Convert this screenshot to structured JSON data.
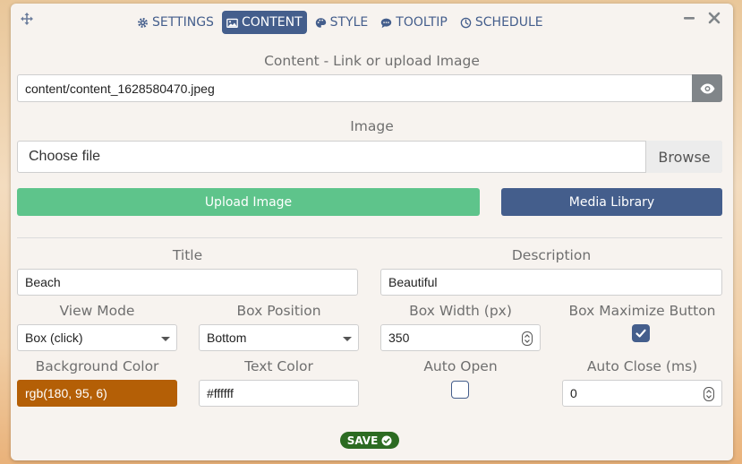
{
  "tabs": [
    {
      "label": "SETTINGS",
      "icon": "gear-icon"
    },
    {
      "label": "CONTENT",
      "icon": "image-icon",
      "active": true
    },
    {
      "label": "STYLE",
      "icon": "palette-icon"
    },
    {
      "label": "TOOLTIP",
      "icon": "comment-icon"
    },
    {
      "label": "SCHEDULE",
      "icon": "clock-icon"
    }
  ],
  "content": {
    "link_label": "Content - Link or upload Image",
    "link_value": "content/content_1628580470.jpeg",
    "image_label": "Image",
    "file_placeholder": "Choose file",
    "browse_label": "Browse",
    "upload_label": "Upload Image",
    "media_label": "Media Library"
  },
  "fields": {
    "title_label": "Title",
    "title_value": "Beach",
    "description_label": "Description",
    "description_value": "Beautiful",
    "view_mode_label": "View Mode",
    "view_mode_value": "Box (click)",
    "box_position_label": "Box Position",
    "box_position_value": "Bottom",
    "box_width_label": "Box Width (px)",
    "box_width_value": "350",
    "box_max_label": "Box Maximize Button",
    "bg_color_label": "Background Color",
    "bg_color_value": "rgb(180, 95, 6)",
    "text_color_label": "Text Color",
    "text_color_value": "#ffffff",
    "auto_open_label": "Auto Open",
    "auto_close_label": "Auto Close (ms)",
    "auto_close_value": "0"
  },
  "save_label": "SAVE",
  "colors": {
    "accent": "#445e8c",
    "upload": "#5ec48b",
    "bg_swatch": "#b45f06",
    "save": "#2c6b22"
  }
}
